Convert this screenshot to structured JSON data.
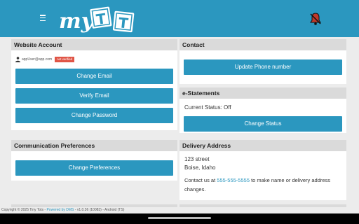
{
  "header": {
    "logo_text_my": "my",
    "logo_block_1": "T",
    "logo_block_2": "T",
    "brand_color": "#2b97bf",
    "menu_icon": "hamburger-menu-icon",
    "notification_icon": "bell-icon"
  },
  "website_account": {
    "title": "Website Account",
    "email": "appUser@app.com",
    "status_badge": "not verified",
    "buttons": [
      "Change Email",
      "Verify Email",
      "Change Password"
    ]
  },
  "contact": {
    "title": "Contact",
    "button": "Update Phone number"
  },
  "estatements": {
    "title": "e-Statements",
    "status": "Current Status: Off",
    "button": "Change Status"
  },
  "communication": {
    "title": "Communication Preferences",
    "button": "Change Preferences"
  },
  "delivery": {
    "title": "Delivery Address",
    "street": "123 street",
    "city": "Boise, Idaho",
    "contact_prefix": "Contact us at ",
    "phone": "555-555-5555",
    "contact_suffix_1": " to make name or delivery address",
    "contact_suffix_2": "changes."
  },
  "footer": {
    "copyright": "Copyright © 2025 Tiny Tots - ",
    "powered": "Powered by DMS",
    "version": " - v1.0.36 (10083) - Android (TS)"
  }
}
